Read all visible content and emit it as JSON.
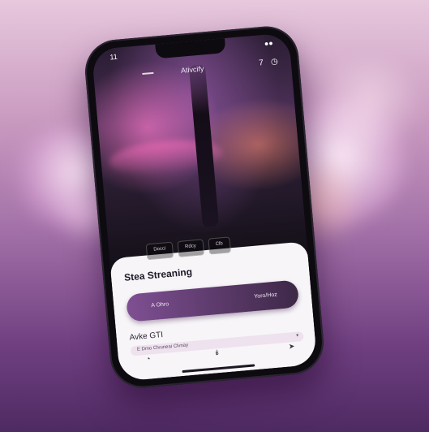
{
  "status": {
    "time": "11",
    "right": "●●"
  },
  "app": {
    "title": "Ativcify",
    "tabs": [
      "Docci",
      "Rdcy",
      "Clb"
    ]
  },
  "sheet": {
    "title": "Stea Streaning",
    "play_left": "A Ohro",
    "play_right": "Yoro/Hoz",
    "subtitle": "Avke GTI",
    "field_text": "E Dmo Clvuneai Clvnay",
    "field_arrow": "▾"
  },
  "icons": {
    "menu": "menu-icon",
    "share": "share-icon",
    "clock": "clock-icon",
    "nav": [
      "home-icon",
      "down-arrow-icon",
      "send-icon"
    ]
  },
  "colors": {
    "accent": "#7f4f93",
    "sheet_bg": "#f7f5f8"
  }
}
